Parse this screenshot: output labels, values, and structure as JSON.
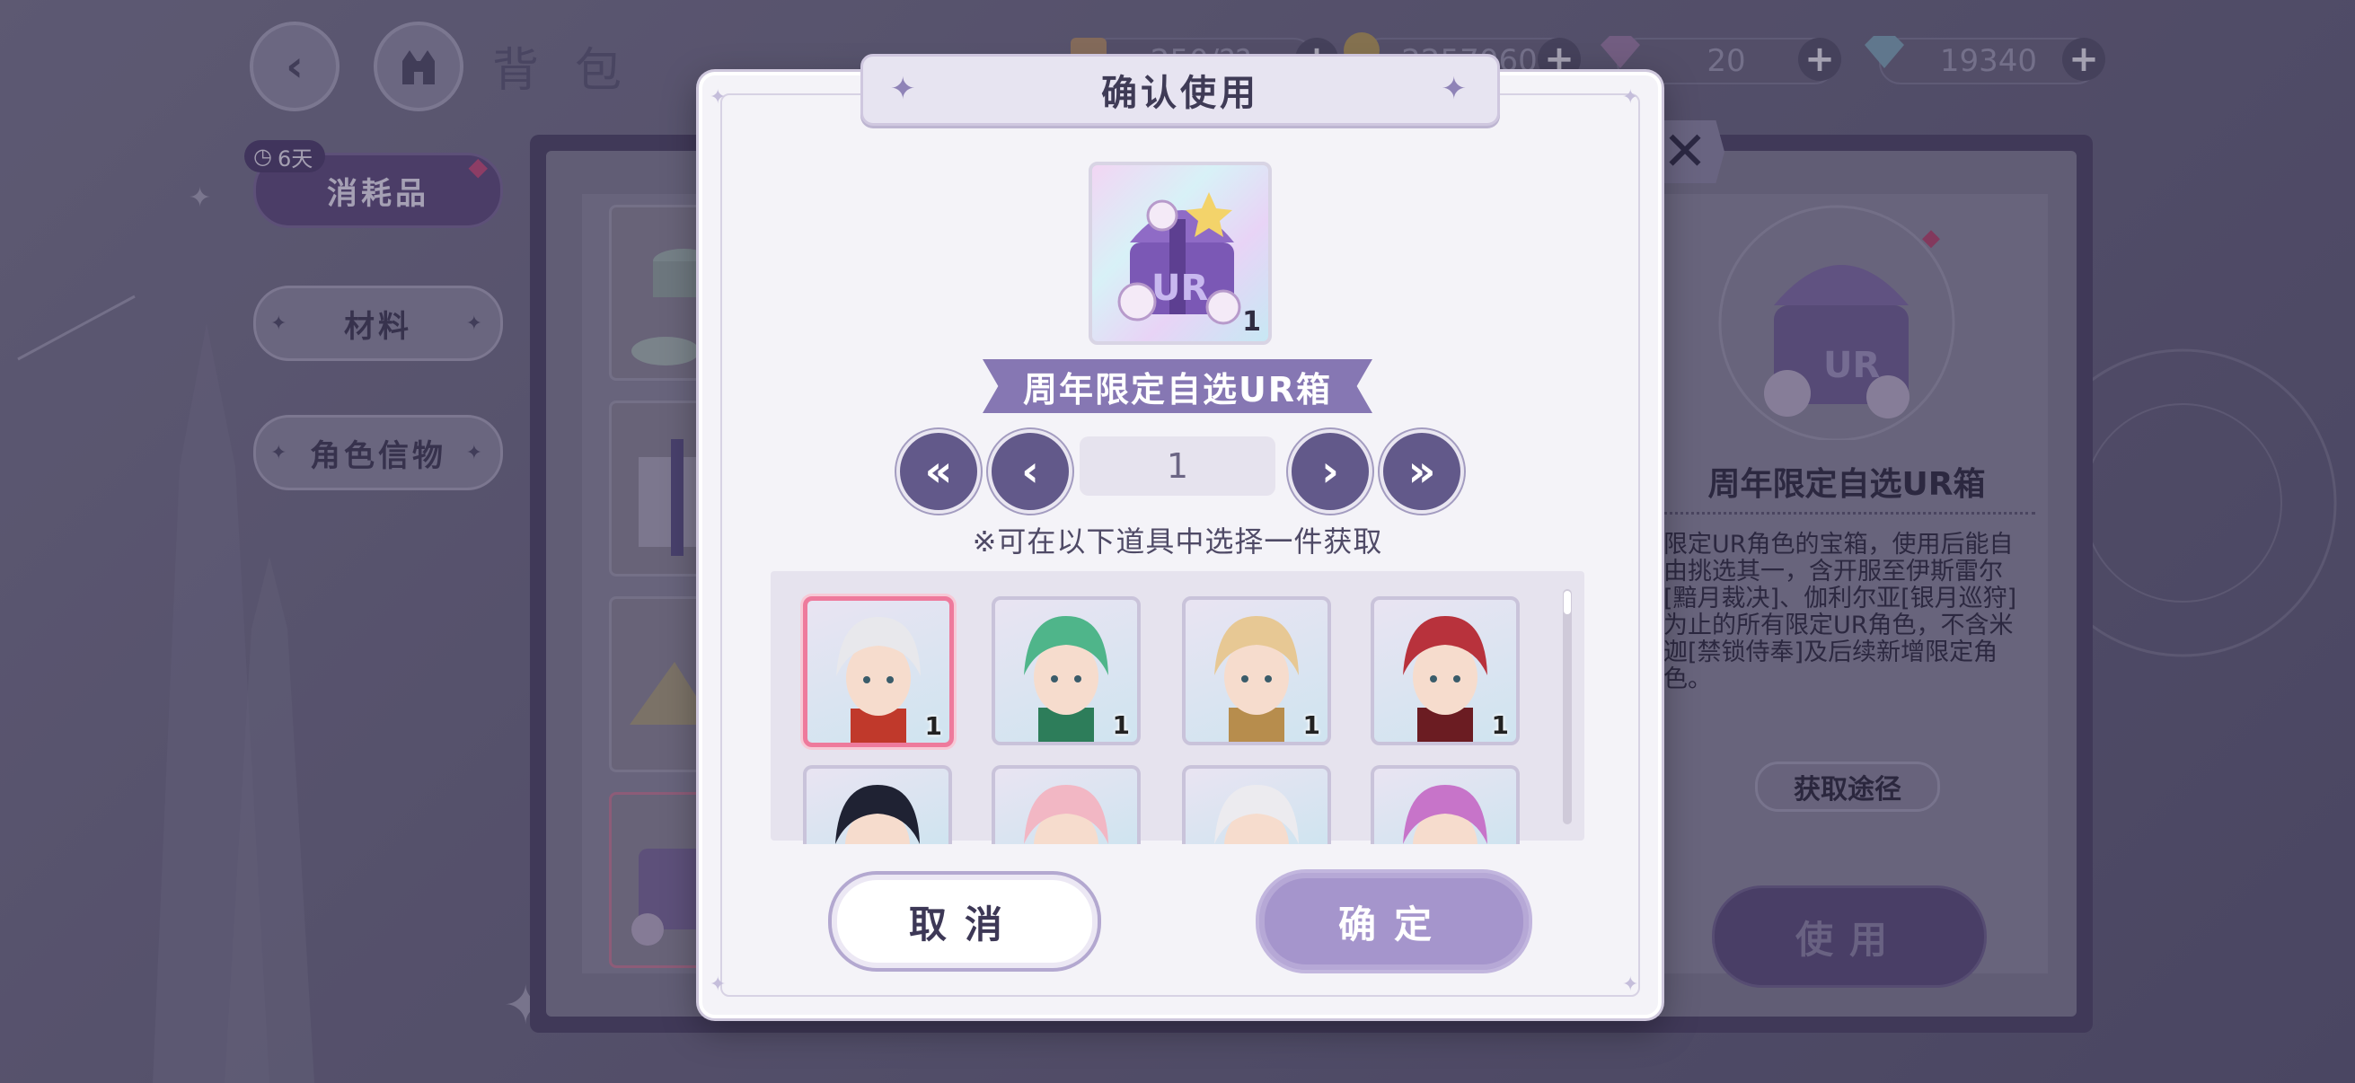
{
  "background": {
    "title": "背包",
    "timer_badge": "6天",
    "tabs": [
      {
        "label": "消耗品",
        "active": true
      },
      {
        "label": "材料",
        "active": false
      },
      {
        "label": "角色信物",
        "active": false
      }
    ],
    "resources": [
      {
        "icon": "ticket-icon",
        "value": "250/??"
      },
      {
        "icon": "coin-icon",
        "value": "2257060"
      },
      {
        "icon": "gem-pink-icon",
        "value": "20"
      },
      {
        "icon": "diamond-icon",
        "value": "19340"
      }
    ],
    "detail": {
      "title": "周年限定自选UR箱",
      "description": "限定UR角色的宝箱，使用后能自由挑选其一，含开服至伊斯雷尔[黯月裁决]、伽利尔亚[银月巡狩]为止的所有限定UR角色，不含米迦[禁锁侍奉]及后续新增限定角色。",
      "route_label": "获取途径",
      "use_label": "使用"
    }
  },
  "dialog": {
    "title": "确认使用",
    "item_name": "周年限定自选UR箱",
    "item_qty": "1",
    "quantity": "1",
    "first_label": "«",
    "prev_label": "‹",
    "next_label": "›",
    "last_label": "»",
    "hint": "※可在以下道具中选择一件获取",
    "options": [
      {
        "qty": "1",
        "selected": true,
        "hair": "#e8e8ec",
        "accent": "#c0392b"
      },
      {
        "qty": "1",
        "selected": false,
        "hair": "#4fb58a",
        "accent": "#2d7d5a"
      },
      {
        "qty": "1",
        "selected": false,
        "hair": "#e7c894",
        "accent": "#b78d4d"
      },
      {
        "qty": "1",
        "selected": false,
        "hair": "#b8323c",
        "accent": "#6b1c22"
      },
      {
        "qty": "",
        "selected": false,
        "hair": "#1f2233",
        "accent": "#3a3f58"
      },
      {
        "qty": "",
        "selected": false,
        "hair": "#f2b7c4",
        "accent": "#d88aa0"
      },
      {
        "qty": "",
        "selected": false,
        "hair": "#ecebef",
        "accent": "#222222"
      },
      {
        "qty": "",
        "selected": false,
        "hair": "#c774c9",
        "accent": "#8e4a93"
      }
    ],
    "cancel_label": "取消",
    "confirm_label": "确定"
  },
  "colors": {
    "accent": "#8677b3",
    "confirm": "#a595cc",
    "selected_border": "#ee7a9c"
  }
}
